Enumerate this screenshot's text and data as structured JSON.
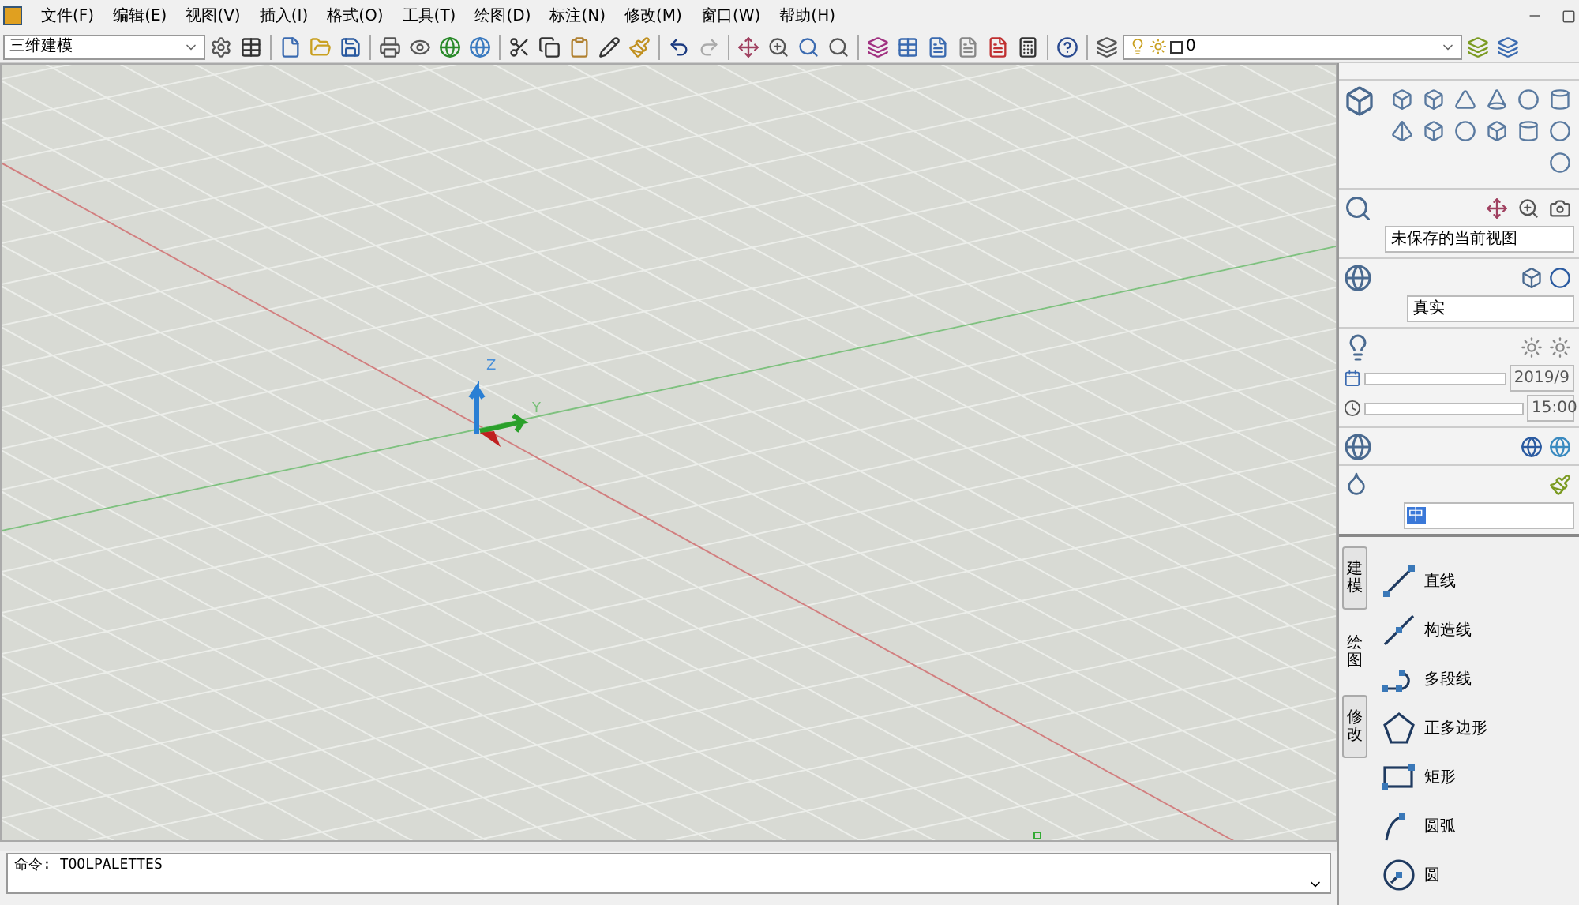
{
  "menu_bar": {
    "items": [
      "文件(F)",
      "编辑(E)",
      "视图(V)",
      "插入(I)",
      "格式(O)",
      "工具(T)",
      "绘图(D)",
      "标注(N)",
      "修改(M)",
      "窗口(W)",
      "帮助(H)"
    ]
  },
  "toolbar": {
    "workspace": "三维建模",
    "layer": "0"
  },
  "canvas": {
    "axis_labels": [
      "Z",
      "Y"
    ]
  },
  "dashboard": {
    "view": "未保存的当前视图",
    "visual_style": "真实",
    "date_slider": {
      "level": 0
    },
    "date": "2019/9",
    "time_slider": {
      "level": 0
    },
    "time": "15:00",
    "material": "中"
  },
  "tool_palette": {
    "tabs": [
      {
        "label": "建模",
        "selected": false
      },
      {
        "label": "绘图",
        "selected": true
      },
      {
        "label": "修改",
        "selected": false
      }
    ],
    "items": [
      {
        "label": "直线",
        "kind": "line"
      },
      {
        "label": "构造线",
        "kind": "xline"
      },
      {
        "label": "多段线",
        "kind": "polyline"
      },
      {
        "label": "正多边形",
        "kind": "polygon"
      },
      {
        "label": "矩形",
        "kind": "rectangle"
      },
      {
        "label": "圆弧",
        "kind": "arc"
      },
      {
        "label": "圆",
        "kind": "circle"
      }
    ]
  },
  "command_line": {
    "text": "命令: TOOLPALETTES"
  }
}
